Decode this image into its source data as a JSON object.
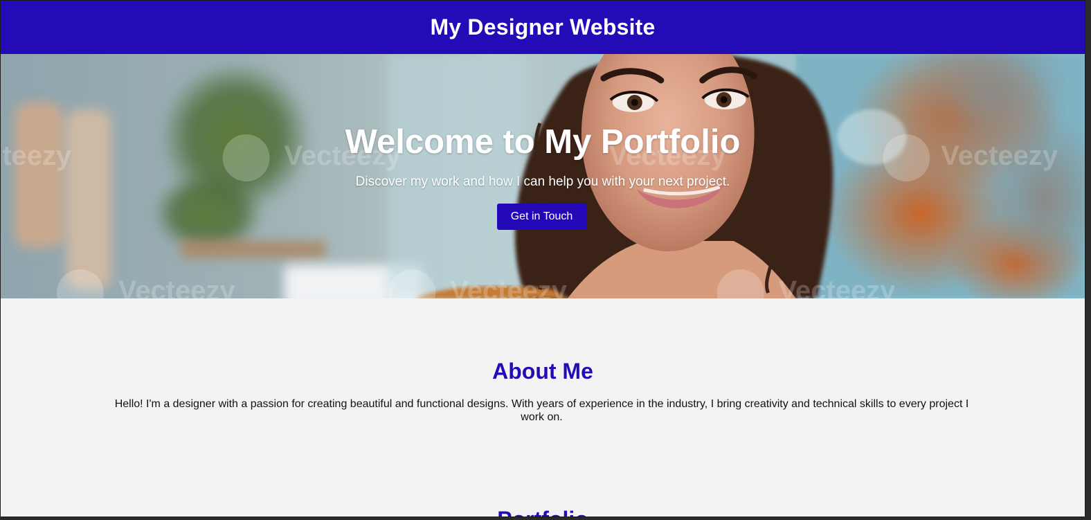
{
  "colors": {
    "header_bg": "#230cb5",
    "accent": "#230cb5",
    "button_bg": "#2308b8",
    "page_bg": "#f3f3f3"
  },
  "header": {
    "title": "My Designer Website"
  },
  "hero": {
    "heading": "Welcome to My Portfolio",
    "subheading": "Discover my work and how I can help you with your next project.",
    "button_label": "Get in Touch",
    "watermark": "Vecteezy"
  },
  "about": {
    "heading": "About Me",
    "text": "Hello! I'm a designer with a passion for creating beautiful and functional designs. With years of experience in the industry, I bring creativity and technical skills to every project I work on."
  },
  "portfolio": {
    "heading": "Portfolio"
  }
}
